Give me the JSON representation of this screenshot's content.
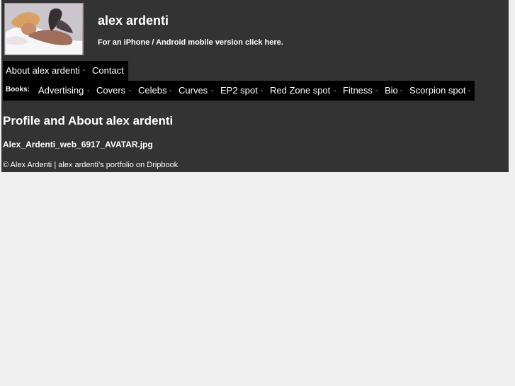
{
  "header": {
    "title": "alex ardenti",
    "mobile_text_prefix": "For an iPhone / Android mobile version",
    "mobile_link": "click here."
  },
  "main_nav": {
    "items": [
      {
        "label": "About alex ardenti",
        "separator": "-"
      },
      {
        "label": "Contact"
      }
    ]
  },
  "books_nav": {
    "label": "Books:",
    "items": [
      {
        "label": "Advertising",
        "separator": "-"
      },
      {
        "label": "Covers",
        "separator": "-"
      },
      {
        "label": "Celebs",
        "separator": "-"
      },
      {
        "label": "Curves",
        "separator": "-"
      },
      {
        "label": "EP2 spot",
        "separator": "-"
      },
      {
        "label": "Red Zone spot",
        "separator": "-"
      },
      {
        "label": "Fitness",
        "separator": "-"
      },
      {
        "label": "Bio",
        "separator": "-"
      },
      {
        "label": "Scorpion spot",
        "separator": "-"
      }
    ]
  },
  "content": {
    "heading": "Profile and About alex ardenti",
    "image_filename": "Alex_Ardenti_web_6917_AVATAR.jpg"
  },
  "footer": {
    "copyright": "© Alex Ardenti",
    "separator": "|",
    "portfolio_link": "alex ardenti's portfolio on Dripbook"
  },
  "colors": {
    "page_background": "#efefef",
    "panel_background": "#333333",
    "nav_background": "#000000",
    "text": "#ffffff"
  }
}
